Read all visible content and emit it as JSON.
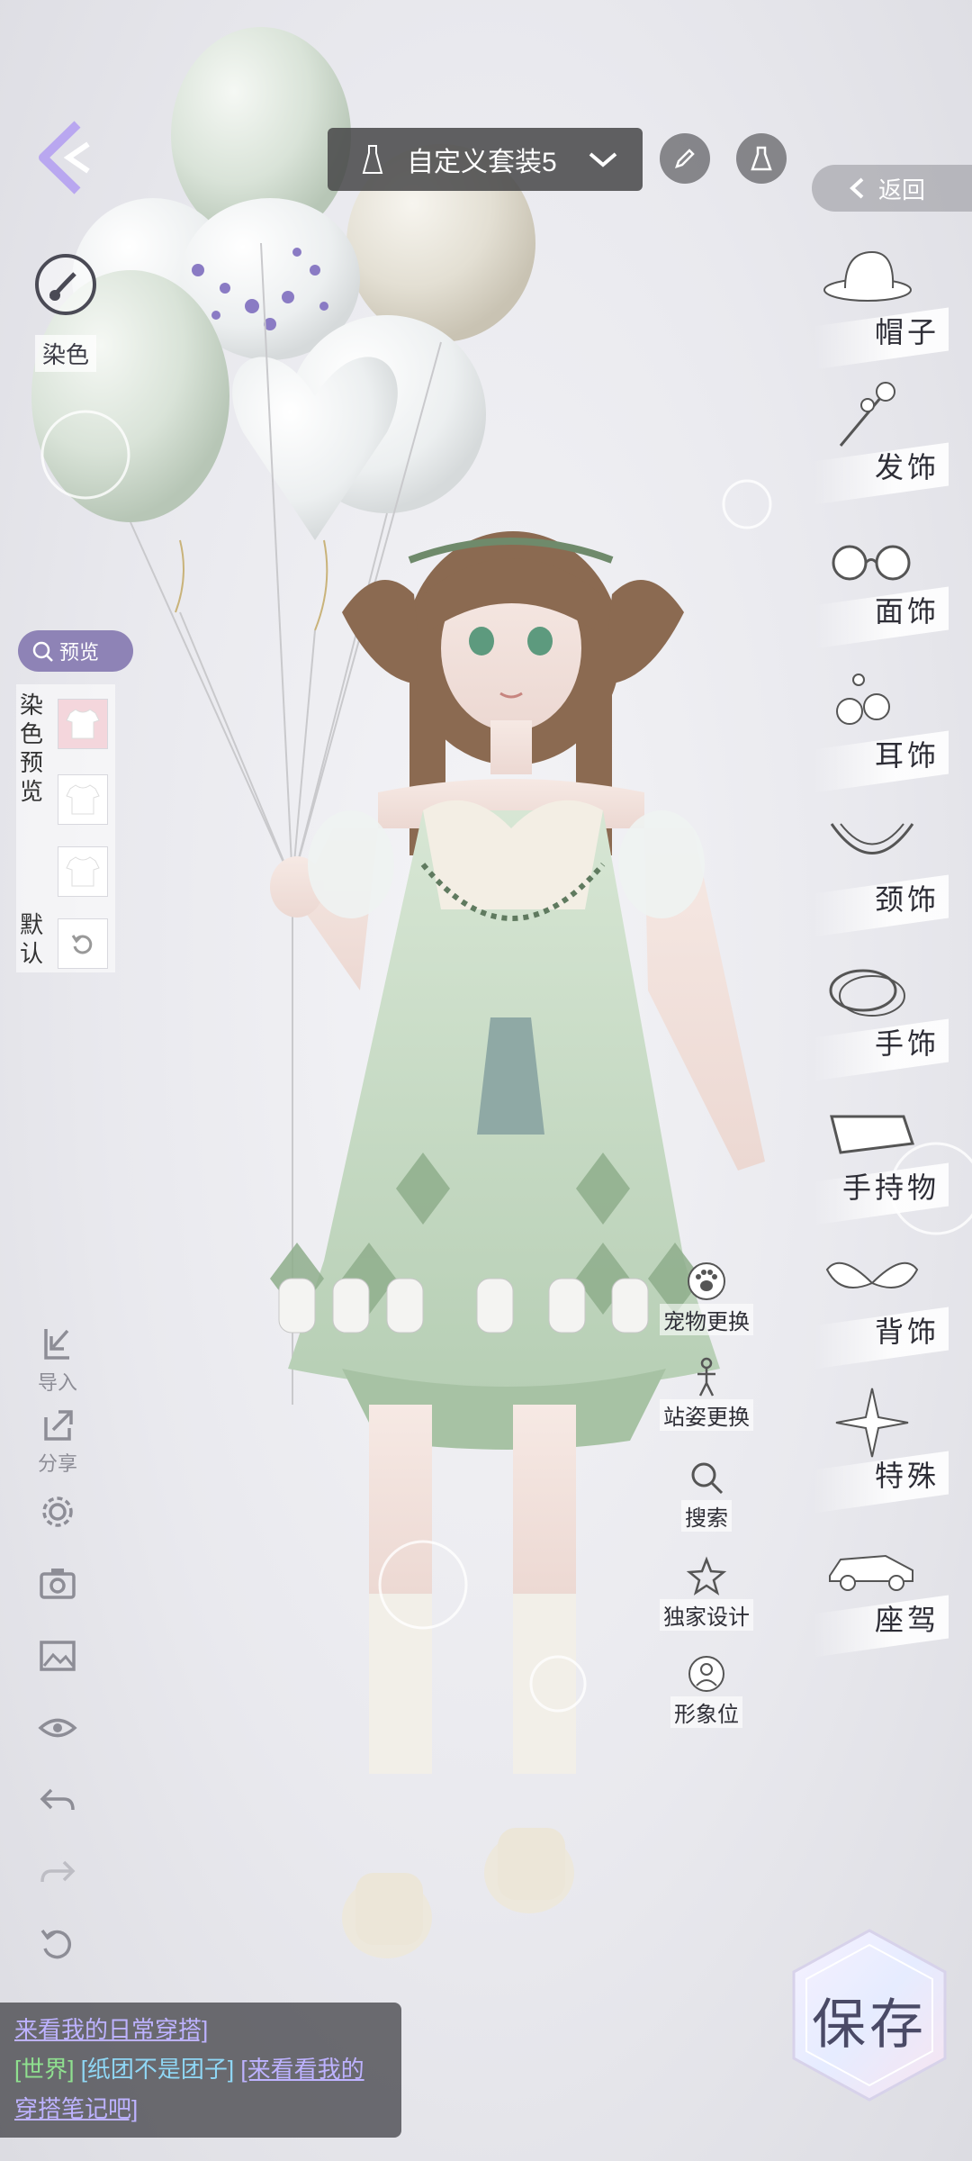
{
  "header": {
    "outfit_name": "自定义套装5",
    "return_label": "返回"
  },
  "left_panel": {
    "dye_label": "染色",
    "preview_toggle_label": "预览",
    "dye_preview_title": "染色预览",
    "default_title": "默认"
  },
  "tools": [
    {
      "label": "导入",
      "icon": "import-icon"
    },
    {
      "label": "分享",
      "icon": "share-icon"
    },
    {
      "label": "",
      "icon": "gear-icon"
    },
    {
      "label": "",
      "icon": "camera-icon"
    },
    {
      "label": "",
      "icon": "image-icon"
    },
    {
      "label": "",
      "icon": "eye-icon"
    },
    {
      "label": "",
      "icon": "undo-icon"
    },
    {
      "label": "",
      "icon": "redo-icon"
    },
    {
      "label": "",
      "icon": "reset-icon"
    }
  ],
  "categories": [
    {
      "label": "帽子",
      "icon": "hat-icon"
    },
    {
      "label": "发饰",
      "icon": "hairpin-icon"
    },
    {
      "label": "面饰",
      "icon": "glasses-icon"
    },
    {
      "label": "耳饰",
      "icon": "earring-icon"
    },
    {
      "label": "颈饰",
      "icon": "necklace-icon"
    },
    {
      "label": "手饰",
      "icon": "bracelet-icon"
    },
    {
      "label": "手持物",
      "icon": "handheld-icon"
    },
    {
      "label": "背饰",
      "icon": "wings-icon"
    },
    {
      "label": "特殊",
      "icon": "star-burst-icon"
    },
    {
      "label": "座驾",
      "icon": "car-icon"
    }
  ],
  "actions": [
    {
      "label": "宠物更换",
      "icon": "paw-icon"
    },
    {
      "label": "站姿更换",
      "icon": "pose-icon"
    },
    {
      "label": "搜索",
      "icon": "search-icon"
    },
    {
      "label": "独家设计",
      "icon": "star-icon"
    },
    {
      "label": "形象位",
      "icon": "avatar-slot-icon"
    }
  ],
  "save_label": "保存",
  "chat": {
    "line1": "来看我的日常穿搭]",
    "channel": "[世界]",
    "user": "[纸团不是团子]",
    "message": "[来看看我的穿搭笔记吧]"
  },
  "colors": {
    "accent": "#8e83b6",
    "dress": "#c8dcc6",
    "hair": "#8a6a52"
  }
}
